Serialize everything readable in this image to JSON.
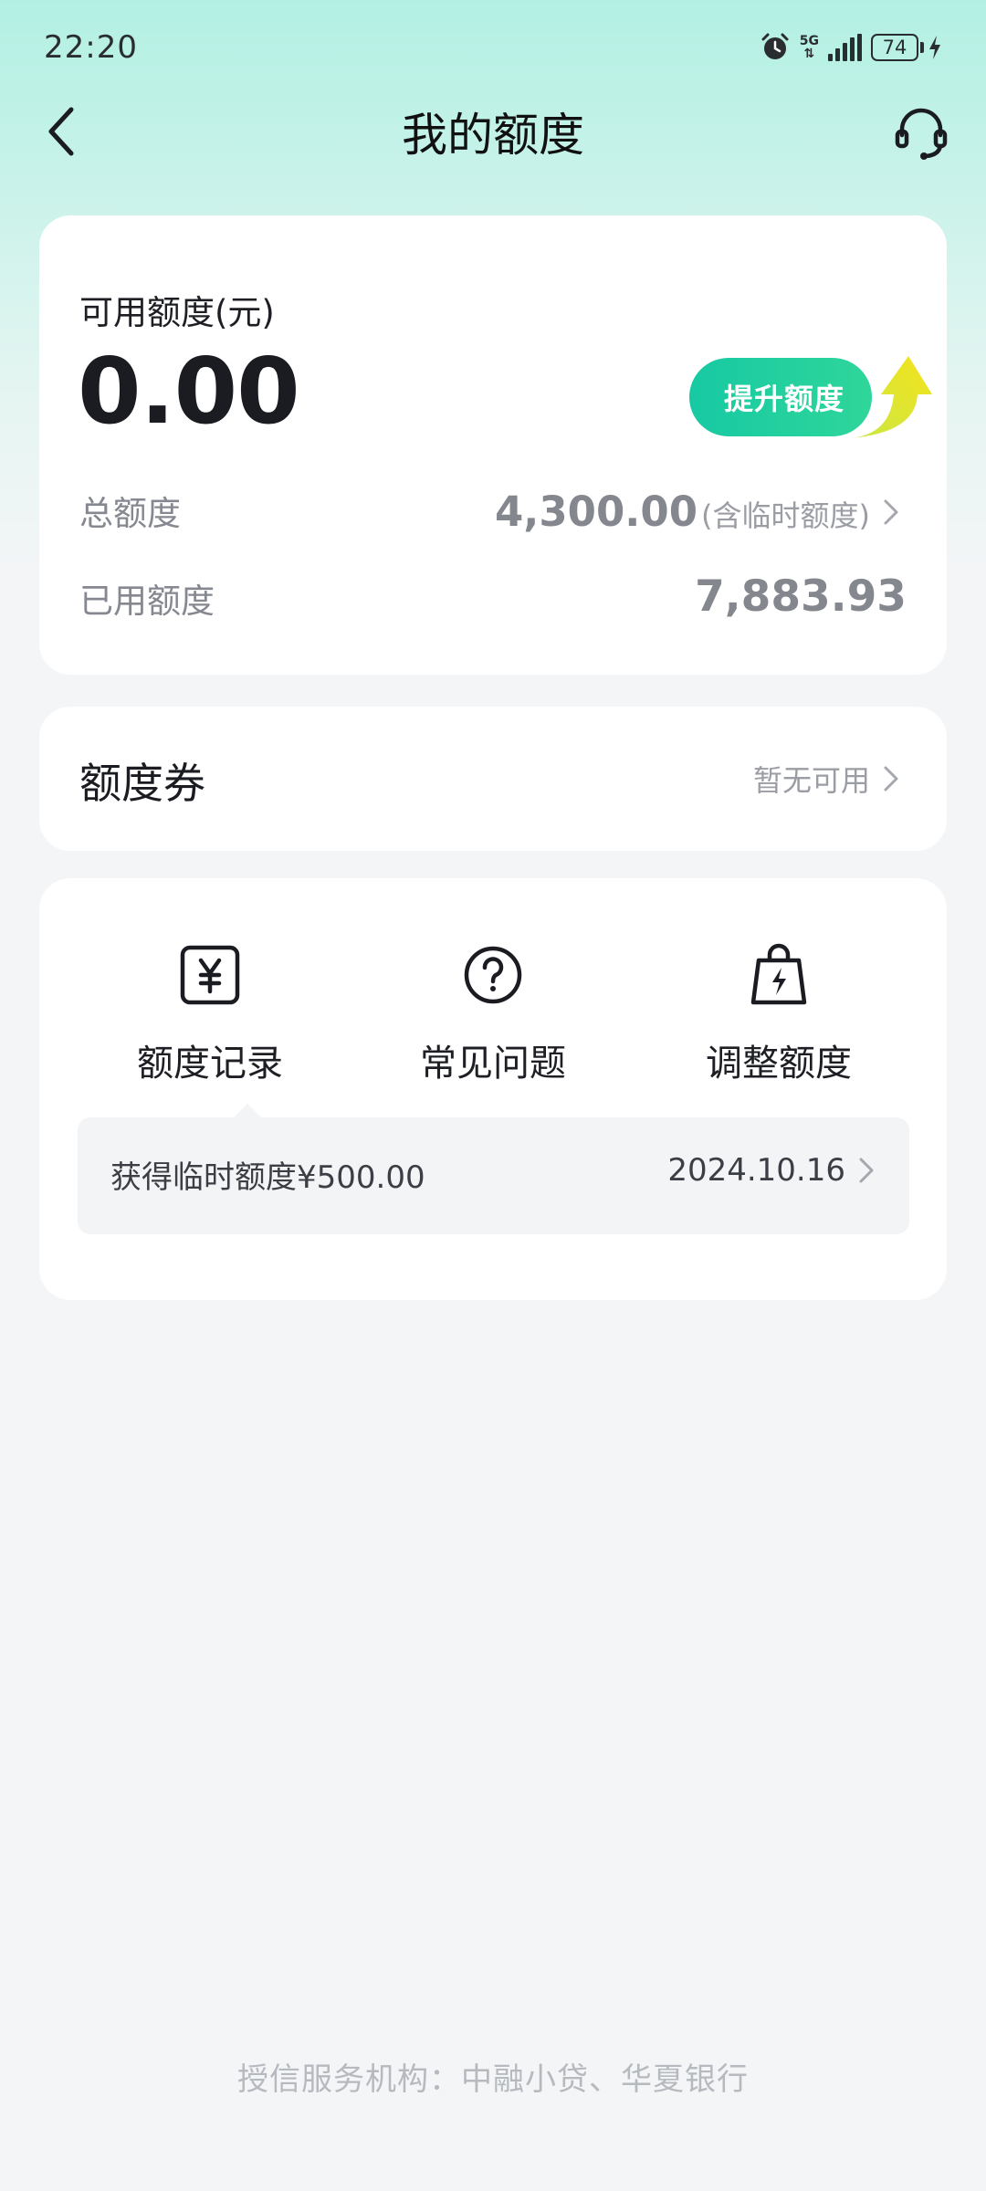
{
  "status_bar": {
    "time": "22:20",
    "network": "5G",
    "battery": "74"
  },
  "nav": {
    "title": "我的额度"
  },
  "quota_card": {
    "available_label": "可用额度(元)",
    "available_amount": "0.00",
    "raise_button": "提升额度",
    "total_label": "总额度",
    "total_amount": "4,300.00",
    "total_note": "(含临时额度)",
    "used_label": "已用额度",
    "used_amount": "7,883.93"
  },
  "coupon_card": {
    "title": "额度券",
    "status": "暂无可用"
  },
  "actions": [
    {
      "label": "额度记录",
      "icon": "yuan-receipt-icon"
    },
    {
      "label": "常见问题",
      "icon": "question-circle-icon"
    },
    {
      "label": "调整额度",
      "icon": "bag-bolt-icon"
    }
  ],
  "record": {
    "text": "获得临时额度¥500.00",
    "date": "2024.10.16"
  },
  "footer": "授信服务机构：中融小贷、华夏银行",
  "colors": {
    "accent": "#1ECBA0",
    "header_gradient_top": "#B3F0E3",
    "background": "#F3F5F7"
  }
}
